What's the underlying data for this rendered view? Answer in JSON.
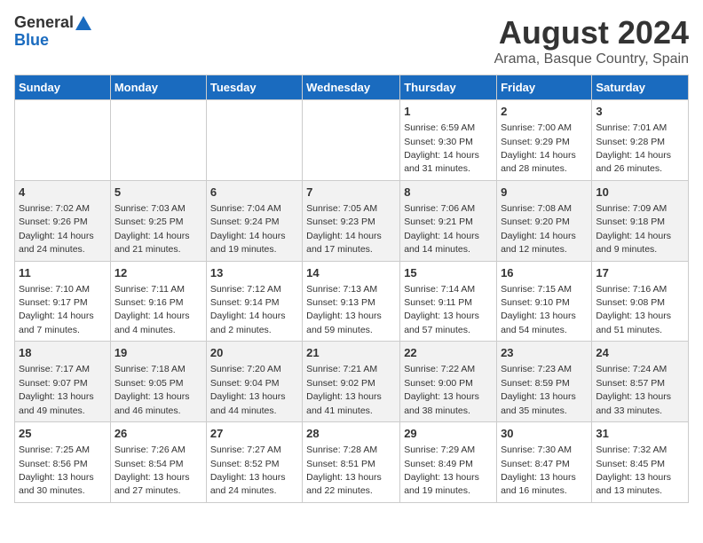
{
  "header": {
    "logo_general": "General",
    "logo_blue": "Blue",
    "month_year": "August 2024",
    "location": "Arama, Basque Country, Spain"
  },
  "days_of_week": [
    "Sunday",
    "Monday",
    "Tuesday",
    "Wednesday",
    "Thursday",
    "Friday",
    "Saturday"
  ],
  "weeks": [
    [
      {
        "day": "",
        "info": ""
      },
      {
        "day": "",
        "info": ""
      },
      {
        "day": "",
        "info": ""
      },
      {
        "day": "",
        "info": ""
      },
      {
        "day": "1",
        "info": "Sunrise: 6:59 AM\nSunset: 9:30 PM\nDaylight: 14 hours\nand 31 minutes."
      },
      {
        "day": "2",
        "info": "Sunrise: 7:00 AM\nSunset: 9:29 PM\nDaylight: 14 hours\nand 28 minutes."
      },
      {
        "day": "3",
        "info": "Sunrise: 7:01 AM\nSunset: 9:28 PM\nDaylight: 14 hours\nand 26 minutes."
      }
    ],
    [
      {
        "day": "4",
        "info": "Sunrise: 7:02 AM\nSunset: 9:26 PM\nDaylight: 14 hours\nand 24 minutes."
      },
      {
        "day": "5",
        "info": "Sunrise: 7:03 AM\nSunset: 9:25 PM\nDaylight: 14 hours\nand 21 minutes."
      },
      {
        "day": "6",
        "info": "Sunrise: 7:04 AM\nSunset: 9:24 PM\nDaylight: 14 hours\nand 19 minutes."
      },
      {
        "day": "7",
        "info": "Sunrise: 7:05 AM\nSunset: 9:23 PM\nDaylight: 14 hours\nand 17 minutes."
      },
      {
        "day": "8",
        "info": "Sunrise: 7:06 AM\nSunset: 9:21 PM\nDaylight: 14 hours\nand 14 minutes."
      },
      {
        "day": "9",
        "info": "Sunrise: 7:08 AM\nSunset: 9:20 PM\nDaylight: 14 hours\nand 12 minutes."
      },
      {
        "day": "10",
        "info": "Sunrise: 7:09 AM\nSunset: 9:18 PM\nDaylight: 14 hours\nand 9 minutes."
      }
    ],
    [
      {
        "day": "11",
        "info": "Sunrise: 7:10 AM\nSunset: 9:17 PM\nDaylight: 14 hours\nand 7 minutes."
      },
      {
        "day": "12",
        "info": "Sunrise: 7:11 AM\nSunset: 9:16 PM\nDaylight: 14 hours\nand 4 minutes."
      },
      {
        "day": "13",
        "info": "Sunrise: 7:12 AM\nSunset: 9:14 PM\nDaylight: 14 hours\nand 2 minutes."
      },
      {
        "day": "14",
        "info": "Sunrise: 7:13 AM\nSunset: 9:13 PM\nDaylight: 13 hours\nand 59 minutes."
      },
      {
        "day": "15",
        "info": "Sunrise: 7:14 AM\nSunset: 9:11 PM\nDaylight: 13 hours\nand 57 minutes."
      },
      {
        "day": "16",
        "info": "Sunrise: 7:15 AM\nSunset: 9:10 PM\nDaylight: 13 hours\nand 54 minutes."
      },
      {
        "day": "17",
        "info": "Sunrise: 7:16 AM\nSunset: 9:08 PM\nDaylight: 13 hours\nand 51 minutes."
      }
    ],
    [
      {
        "day": "18",
        "info": "Sunrise: 7:17 AM\nSunset: 9:07 PM\nDaylight: 13 hours\nand 49 minutes."
      },
      {
        "day": "19",
        "info": "Sunrise: 7:18 AM\nSunset: 9:05 PM\nDaylight: 13 hours\nand 46 minutes."
      },
      {
        "day": "20",
        "info": "Sunrise: 7:20 AM\nSunset: 9:04 PM\nDaylight: 13 hours\nand 44 minutes."
      },
      {
        "day": "21",
        "info": "Sunrise: 7:21 AM\nSunset: 9:02 PM\nDaylight: 13 hours\nand 41 minutes."
      },
      {
        "day": "22",
        "info": "Sunrise: 7:22 AM\nSunset: 9:00 PM\nDaylight: 13 hours\nand 38 minutes."
      },
      {
        "day": "23",
        "info": "Sunrise: 7:23 AM\nSunset: 8:59 PM\nDaylight: 13 hours\nand 35 minutes."
      },
      {
        "day": "24",
        "info": "Sunrise: 7:24 AM\nSunset: 8:57 PM\nDaylight: 13 hours\nand 33 minutes."
      }
    ],
    [
      {
        "day": "25",
        "info": "Sunrise: 7:25 AM\nSunset: 8:56 PM\nDaylight: 13 hours\nand 30 minutes."
      },
      {
        "day": "26",
        "info": "Sunrise: 7:26 AM\nSunset: 8:54 PM\nDaylight: 13 hours\nand 27 minutes."
      },
      {
        "day": "27",
        "info": "Sunrise: 7:27 AM\nSunset: 8:52 PM\nDaylight: 13 hours\nand 24 minutes."
      },
      {
        "day": "28",
        "info": "Sunrise: 7:28 AM\nSunset: 8:51 PM\nDaylight: 13 hours\nand 22 minutes."
      },
      {
        "day": "29",
        "info": "Sunrise: 7:29 AM\nSunset: 8:49 PM\nDaylight: 13 hours\nand 19 minutes."
      },
      {
        "day": "30",
        "info": "Sunrise: 7:30 AM\nSunset: 8:47 PM\nDaylight: 13 hours\nand 16 minutes."
      },
      {
        "day": "31",
        "info": "Sunrise: 7:32 AM\nSunset: 8:45 PM\nDaylight: 13 hours\nand 13 minutes."
      }
    ]
  ]
}
